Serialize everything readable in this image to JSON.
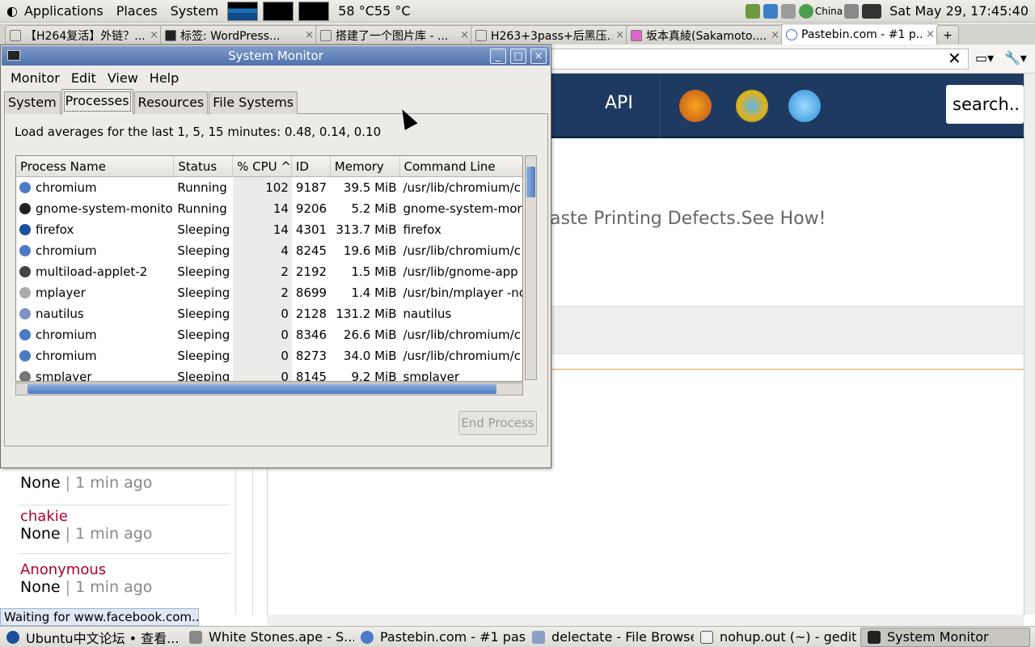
{
  "top_panel": {
    "menus": [
      "Applications",
      "Places",
      "System"
    ],
    "temps": "58 °C55 °C",
    "tray_label": "China",
    "clock": "Sat May 29, 17:45:40"
  },
  "browser": {
    "tabs": [
      "【H264复活】外链？...",
      "标签: WordPress...",
      "搭建了一个图片库 - ...",
      "H263+3pass+后黑压...",
      "坂本真綾(Sakamoto....",
      "Pastebin.com - #1 p..."
    ],
    "tab_close": "×",
    "navbar": {
      "api": "API",
      "search": "search.."
    },
    "ad_text": "aste Printing Defects.See How!",
    "status": "Waiting for www.facebook.com...",
    "pastes": [
      {
        "name": "",
        "lang": "None",
        "ago": "1 min ago"
      },
      {
        "name": "chakie",
        "lang": "None",
        "ago": "1 min ago"
      },
      {
        "name": "Anonymous",
        "lang": "None",
        "ago": "1 min ago"
      }
    ],
    "sep": "|"
  },
  "sysmon": {
    "title": "System Monitor",
    "menu": [
      "Monitor",
      "Edit",
      "View",
      "Help"
    ],
    "tabs": [
      "System",
      "Processes",
      "Resources",
      "File Systems"
    ],
    "load_avg": "Load averages for the last 1, 5, 15 minutes: 0.48, 0.14, 0.10",
    "columns": [
      "Process Name",
      "Status",
      "% CPU ^",
      "ID",
      "Memory",
      "Command Line"
    ],
    "rows": [
      [
        "chromium",
        "Running",
        "102",
        "9187",
        "39.5 MiB",
        "/usr/lib/chromium/c"
      ],
      [
        "gnome-system-monitor",
        "Running",
        "14",
        "9206",
        "5.2 MiB",
        "gnome-system-mor"
      ],
      [
        "firefox",
        "Sleeping",
        "14",
        "4301",
        "313.7 MiB",
        "firefox"
      ],
      [
        "chromium",
        "Sleeping",
        "4",
        "8245",
        "19.6 MiB",
        "/usr/lib/chromium/c"
      ],
      [
        "multiload-applet-2",
        "Sleeping",
        "2",
        "2192",
        "1.5 MiB",
        "/usr/lib/gnome-app"
      ],
      [
        "mplayer",
        "Sleeping",
        "2",
        "8699",
        "1.4 MiB",
        "/usr/bin/mplayer -nc"
      ],
      [
        "nautilus",
        "Sleeping",
        "0",
        "2128",
        "131.2 MiB",
        "nautilus"
      ],
      [
        "chromium",
        "Sleeping",
        "0",
        "8346",
        "26.6 MiB",
        "/usr/lib/chromium/c"
      ],
      [
        "chromium",
        "Sleeping",
        "0",
        "8273",
        "34.0 MiB",
        "/usr/lib/chromium/c"
      ],
      [
        "smplayer",
        "Sleeping",
        "0",
        "8145",
        "9.2 MiB",
        "smplayer"
      ]
    ],
    "end_process": "End Process",
    "win_buttons": [
      "_",
      "□",
      "×"
    ]
  },
  "taskbar": [
    "Ubuntu中文论坛 • 查看...",
    "White Stones.ape - S...",
    "Pastebin.com - #1 pas...",
    "delectate - File Browser",
    "nohup.out (~) - gedit",
    "System Monitor"
  ]
}
